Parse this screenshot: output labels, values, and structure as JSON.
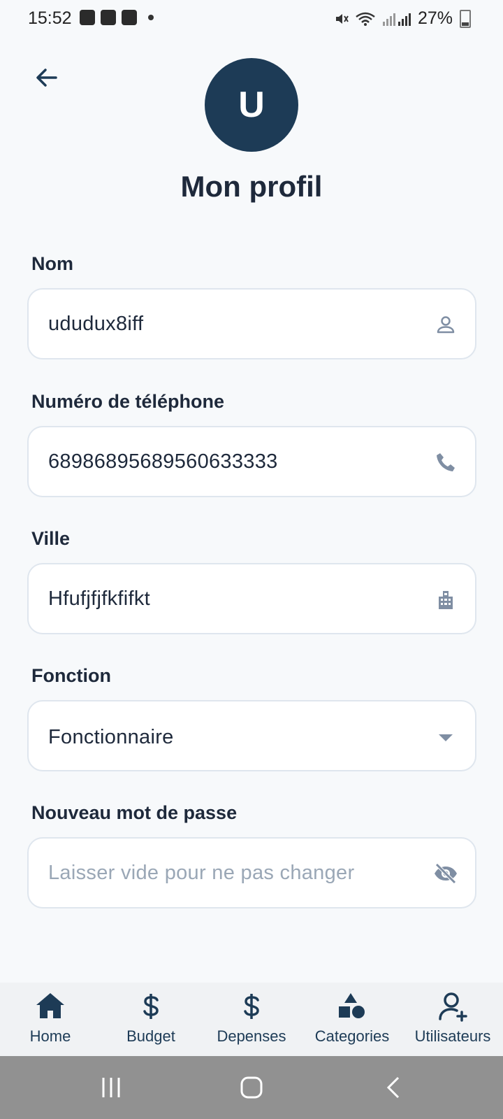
{
  "status_bar": {
    "time": "15:52",
    "battery": "27%",
    "icons": [
      "gallery-icon",
      "youtube-icon",
      "checkbox-icon",
      "mute-icon",
      "wifi-icon",
      "signal-icon"
    ]
  },
  "header": {
    "avatar_letter": "U",
    "title": "Mon profil"
  },
  "form": {
    "nom": {
      "label": "Nom",
      "value": "ududux8iff",
      "icon": "person-icon"
    },
    "telephone": {
      "label": "Numéro de téléphone",
      "value": "68986895689560633333",
      "icon": "phone-icon"
    },
    "ville": {
      "label": "Ville",
      "value": "Hfufjfjfkfifkt",
      "icon": "city-icon"
    },
    "fonction": {
      "label": "Fonction",
      "value": "Fonctionnaire",
      "icon": "dropdown-arrow-icon"
    },
    "password": {
      "label": "Nouveau mot de passe",
      "placeholder": "Laisser vide pour ne pas changer",
      "icon": "eye-off-icon"
    }
  },
  "bottom_nav": {
    "items": [
      {
        "label": "Home",
        "icon": "home-icon"
      },
      {
        "label": "Budget",
        "icon": "dollar-icon"
      },
      {
        "label": "Depenses",
        "icon": "dollar-icon"
      },
      {
        "label": "Categories",
        "icon": "shapes-icon"
      },
      {
        "label": "Utilisateurs",
        "icon": "add-user-icon"
      }
    ]
  },
  "colors": {
    "primary": "#1d3b56",
    "background": "#f7f9fb",
    "border": "#dfe6ee",
    "icon_muted": "#7f8ea3",
    "placeholder": "#9aa7b6"
  }
}
